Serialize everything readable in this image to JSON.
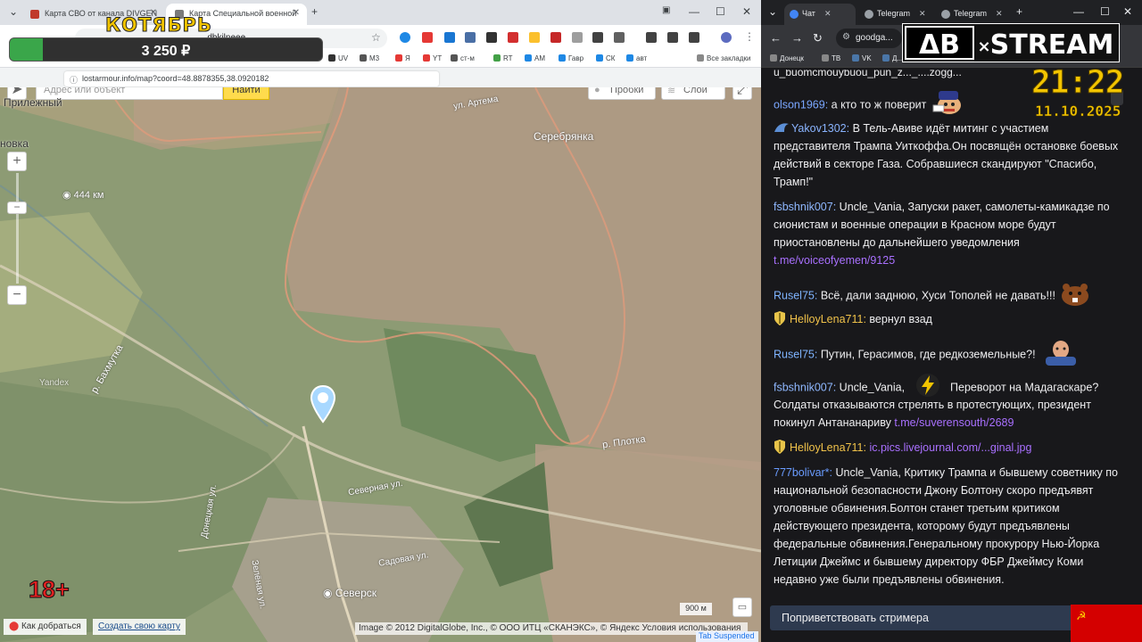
{
  "left_browser": {
    "tabs": [
      {
        "label": "Карта СВО от канала DIVGEN"
      },
      {
        "label": "Карта Специальной военной"
      }
    ],
    "address": "lostarmour.info/map?coord=48.8878355,38.0920182",
    "omnibox": "...dbkilneee...",
    "bookmarks": [
      "UV",
      "M3",
      "Я",
      "YT",
      "ст-м",
      "RT",
      "АМ",
      "Гавр",
      "СК",
      "авт",
      "Все закладки"
    ],
    "colors": {
      "accent": "#3aa64a"
    }
  },
  "overlay": {
    "month": "КОТЯБРЬ",
    "amount": "3 250 ₽",
    "progress_percent": 10.5,
    "age_rating": "18+"
  },
  "map": {
    "search_placeholder": "Адрес или объект",
    "search_button": "Найти",
    "traffic_button": "Пробки",
    "layers_button": "Слои",
    "zoom_in": "+",
    "zoom_out": "−",
    "labels": {
      "top_left": "Прилежный",
      "left_mid": "новка",
      "km_marker": "444 км",
      "street_artema": "ул. Артема",
      "village_top": "Серебрянка",
      "river_bakhmutka": "р. Бахмутка",
      "yandex_watermark": "Yandex",
      "river_plotka": "р. Плотка",
      "street_severnaya": "Северная ул.",
      "street_sadovaya": "Садовая ул.",
      "street_donetskaya": "Донецкая ул.",
      "street_zelenaya": "Зелёная ул.",
      "town": "Северск"
    },
    "route_link": "Как добраться",
    "create_map_link": "Создать свою карту",
    "copyright": "Image © 2012 DigitalGlobe, Inc., © ООО ИТЦ «СКАНЭКС», © Яндекс Условия использования",
    "scale": "900 м",
    "tab_suspended": "Tab Suspended"
  },
  "right_browser": {
    "tabs": [
      {
        "label": "Чат"
      },
      {
        "label": "Telegram"
      },
      {
        "label": "Telegram"
      }
    ],
    "omnibox": "goodga...",
    "bookmarks": [
      "Донецк",
      "ТВ",
      "VK",
      "Д..."
    ]
  },
  "stream": {
    "logo_left": "ΔB",
    "logo_x": "×",
    "logo_right": "STREAM",
    "time": "21:22",
    "date": "11.10.2025"
  },
  "chat": {
    "top_cut": "u_buomcmouybuou_pun_z..._....zogg...",
    "messages": [
      {
        "user": "olson1969:",
        "text": " а кто то ж поверит"
      },
      {
        "user": "Yakov1302:",
        "text": " В Тель-Авиве идёт митинг с участием представителя Трампа Уиткоффа.Он посвящён остановке боевых действий в секторе Газа. Собравшиеся скандируют \"Спасибо, Трамп!\""
      },
      {
        "user": "fsbshnik007:",
        "text": " Uncle_Vania, Запуски ракет, самолеты-камикадзе по сионистам и военные операции в Красном море будут приостановлены до дальнейшего уведомления ",
        "link": "t.me/voiceofyemen/9125"
      },
      {
        "user": "Rusel75:",
        "text": " Всё, дали заднюю, Хуси Тополей не давать!!!"
      },
      {
        "user": "HelloyLena711:",
        "text": " вернул взад"
      },
      {
        "user": "Rusel75:",
        "text": " Путин, Герасимов, где редкоземельные?!"
      },
      {
        "user": "fsbshnik007:",
        "text": " Uncle_Vania, ",
        "text2": " Переворот на Мадагаскаре?"
      },
      {
        "text": "Солдаты отказываются стрелять в протестующих, президент покинул Антананариву ",
        "link": "t.me/suverensouth/2689"
      },
      {
        "user": "HelloyLena711:",
        "link": "ic.pics.livejournal.com/...ginal.jpg"
      },
      {
        "user": "777bolivar*:",
        "text": " Uncle_Vania, Критику Трампа и бывшему советнику по национальной безопасности Джону Болтону скоро предъявят уголовные обвинения.Болтон станет третьим критиком действующего президента, которому будут предъявлены федеральные обвинения.Генеральному прокурору Нью-Йорка Летиции Джеймс и бывшему директору ФБР Джеймсу Коми недавно уже были предъявлены обвинения."
      }
    ],
    "user_colors": {
      "olson1969": "#5ea3ff",
      "Yakov1302": "#7fb4ff",
      "fsbshnik007": "#8fb8ff",
      "Rusel75": "#7fb4ff",
      "HelloyLena711": "#f0c24a",
      "777bolivar": "#6a9cff"
    },
    "greet_button": "Поприветствовать стримера"
  }
}
